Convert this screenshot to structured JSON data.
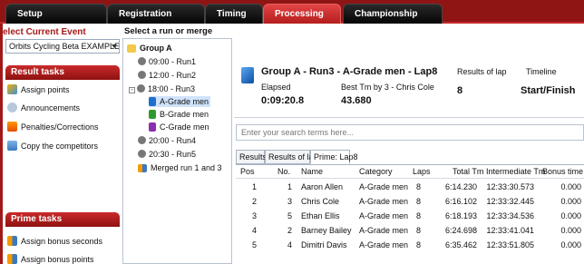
{
  "top_tabs": [
    "Setup",
    "Registration",
    "Timing",
    "Processing",
    "Championship"
  ],
  "left": {
    "select_event_label": "elect Current Event",
    "event_value": "Orbits Cycling Beta EXAMPLE [26-3",
    "result_tasks_header": "Result tasks",
    "result_tasks": [
      "Assign points",
      "Announcements",
      "Penalties/Corrections",
      "Copy the competitors"
    ],
    "prime_tasks_header": "Prime tasks",
    "prime_tasks": [
      "Assign bonus seconds",
      "Assign bonus points"
    ]
  },
  "middle": {
    "header": "Select a run or merge",
    "group": "Group A",
    "runs": [
      "09:00 - Run1",
      "12:00 - Run2",
      "18:00 - Run3",
      "A-Grade men",
      "B-Grade men",
      "C-Grade men",
      "20:00 - Run4",
      "20:30 - Run5",
      "Merged run 1 and 3"
    ]
  },
  "info": {
    "title": "Group A - Run3 - A-Grade men - Lap8",
    "elapsed_label": "Elapsed",
    "elapsed_value": "0:09:20.8",
    "best_label": "Best Tm by 3 - Chris Cole",
    "best_value": "43.680",
    "results_of_lap_label": "Results of lap",
    "results_of_lap_value": "8",
    "timeline_label": "Timeline",
    "timeline_value": "Start/Finish"
  },
  "search": {
    "placeholder": "Enter your search terms here..."
  },
  "subtabs": [
    "Results",
    "Results of lap",
    "Prime: Lap8"
  ],
  "table": {
    "columns": [
      "Pos",
      "No.",
      "Name",
      "Category",
      "Laps",
      "Total Tm",
      "Intermediate Tm",
      "Bonus time"
    ],
    "rows": [
      [
        "1",
        "1",
        "Aaron Allen",
        "A-Grade men",
        "8",
        "6:14.230",
        "12:33:30.573",
        "0.000"
      ],
      [
        "2",
        "3",
        "Chris Cole",
        "A-Grade men",
        "8",
        "6:16.102",
        "12:33:32.445",
        "0.000"
      ],
      [
        "3",
        "5",
        "Ethan Ellis",
        "A-Grade men",
        "8",
        "6:18.193",
        "12:33:34.536",
        "0.000"
      ],
      [
        "4",
        "2",
        "Barney Bailey",
        "A-Grade men",
        "8",
        "6:24.698",
        "12:33:41.041",
        "0.000"
      ],
      [
        "5",
        "4",
        "Dimitri Davis",
        "A-Grade men",
        "8",
        "6:35.462",
        "12:33:51.805",
        "0.000"
      ]
    ]
  },
  "colors": {
    "brand_red": "#8f1414",
    "active_tab": "#d63636"
  },
  "icons": [
    "gear-icon",
    "announce-icon",
    "flag-icon",
    "copy-icon",
    "people-icon",
    "folder-icon",
    "clock-icon",
    "cube-icon"
  ]
}
